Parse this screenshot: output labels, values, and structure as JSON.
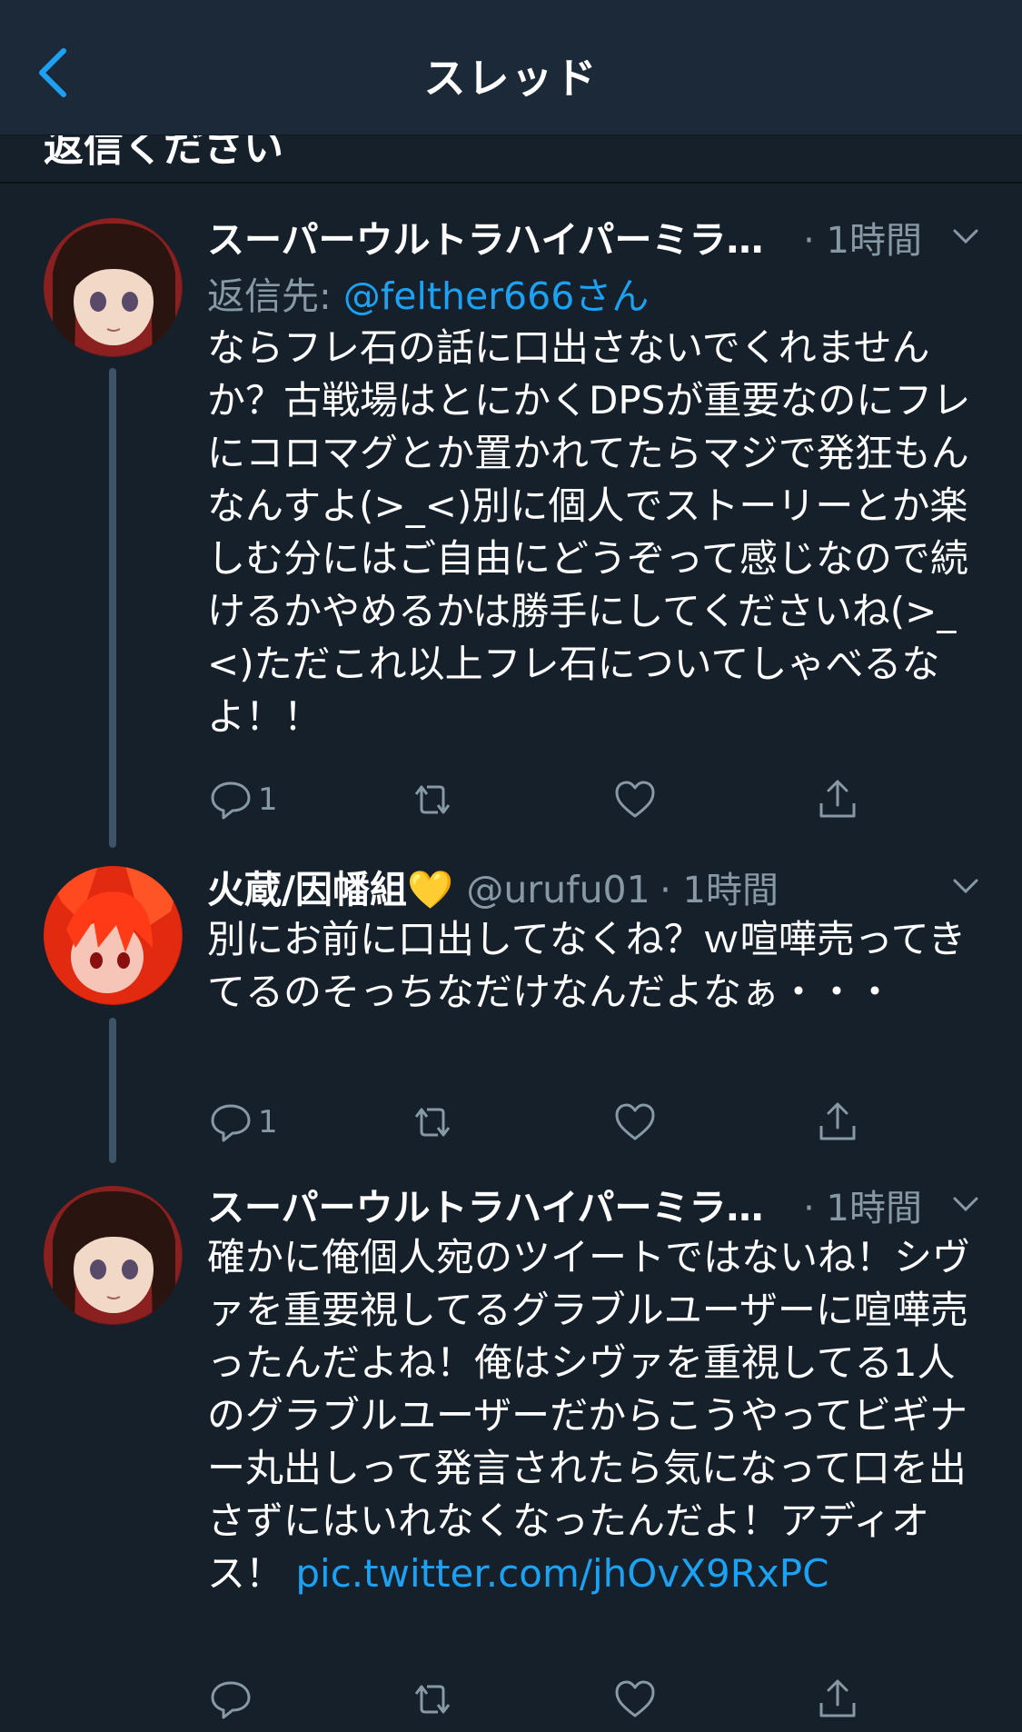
{
  "header": {
    "title": "スレッド"
  },
  "peek": {
    "text": "返信ください"
  },
  "tweets": [
    {
      "name": "スーパーウルトラハイパーミラ…",
      "handle": "",
      "time": "· 1時間",
      "reply_to_prefix": "返信先: ",
      "reply_to_mention": "@felther666さん",
      "text": "ならフレ石の話に口出さないでくれませんか？古戦場はとにかくDPSが重要なのにフレにコロマグとか置かれてたらマジで発狂もんなんすよ(>_<)別に個人でストーリーとか楽しむ分にはご自由にどうぞって感じなので続けるかやめるかは勝手にしてくださいね(>_<)ただこれ以上フレ石についてしゃべるなよ！！",
      "reply_count": "1"
    },
    {
      "name": "火蔵/因幡組💛",
      "handle": "@urufu01",
      "time": "· 1時間",
      "text": "別にお前に口出してなくね？ｗ喧嘩売ってきてるのそっちなだけなんだよなぁ・・・",
      "reply_count": "1"
    },
    {
      "name": "スーパーウルトラハイパーミラ…",
      "handle": "",
      "time": "· 1時間",
      "text": "確かに俺個人宛のツイートではないね！シヴァを重要視してるグラブルユーザーに喧嘩売ったんだよね！俺はシヴァを重視してる1人のグラブルユーザーだからこうやってビギナー丸出しって発言されたら気になって口を出さずにはいれなくなったんだよ！アディオス！ ",
      "link": "pic.twitter.com/jhOvX9RxPC",
      "reply_count": ""
    }
  ],
  "icons": [
    "back-arrow-icon",
    "chevron-down-icon",
    "reply-icon",
    "retweet-icon",
    "like-icon",
    "share-icon"
  ],
  "colors": {
    "background": "#15202b",
    "header": "#1c2938",
    "accent": "#1da1f2",
    "secondary_text": "#8899a6"
  }
}
